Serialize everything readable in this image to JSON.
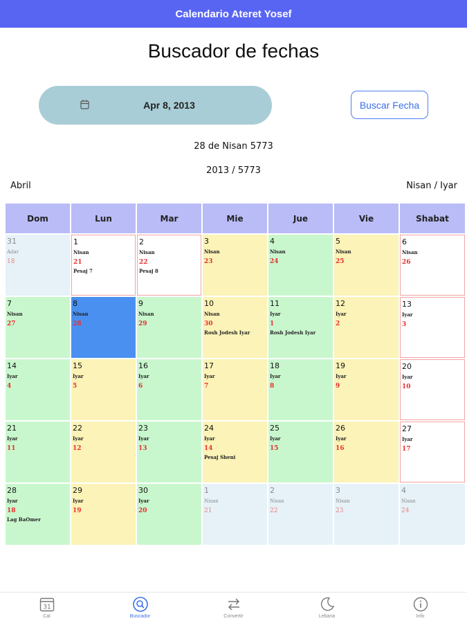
{
  "app": {
    "title": "Calendario Ateret Yosef"
  },
  "page": {
    "title": "Buscador de fechas"
  },
  "search": {
    "date_value": "Apr 8, 2013",
    "button_label": "Buscar Fecha"
  },
  "result": {
    "hebrew_date": "28 de Nisan 5773",
    "years": "2013 / 5773",
    "greg_month": "Abril",
    "hebrew_months": "Nisan / Iyar"
  },
  "calendar": {
    "weekdays": [
      "Dom",
      "Lun",
      "Mar",
      "Mie",
      "Jue",
      "Vie",
      "Shabat"
    ],
    "weeks": [
      [
        {
          "num": "31",
          "month": "Adar",
          "hday": "18",
          "note": "",
          "style": "blue"
        },
        {
          "num": "1",
          "month": "Nisan",
          "hday": "21",
          "note": "Pesaj 7",
          "style": "white"
        },
        {
          "num": "2",
          "month": "Nisan",
          "hday": "22",
          "note": "Pesaj 8",
          "style": "white"
        },
        {
          "num": "3",
          "month": "Nisan",
          "hday": "23",
          "note": "",
          "style": "yellow"
        },
        {
          "num": "4",
          "month": "Nisan",
          "hday": "24",
          "note": "",
          "style": "green"
        },
        {
          "num": "5",
          "month": "Nisan",
          "hday": "25",
          "note": "",
          "style": "yellow"
        },
        {
          "num": "6",
          "month": "Nisan",
          "hday": "26",
          "note": "",
          "style": "white"
        }
      ],
      [
        {
          "num": "7",
          "month": "Nisan",
          "hday": "27",
          "note": "",
          "style": "green"
        },
        {
          "num": "8",
          "month": "Nisan",
          "hday": "28",
          "note": "",
          "style": "selected"
        },
        {
          "num": "9",
          "month": "Nisan",
          "hday": "29",
          "note": "",
          "style": "green"
        },
        {
          "num": "10",
          "month": "Nisan",
          "hday": "30",
          "note": "Rosh Jodesh Iyar",
          "style": "yellow"
        },
        {
          "num": "11",
          "month": "Iyar",
          "hday": "1",
          "note": "Rosh Jodesh Iyar",
          "style": "green"
        },
        {
          "num": "12",
          "month": "Iyar",
          "hday": "2",
          "note": "",
          "style": "yellow"
        },
        {
          "num": "13",
          "month": "Iyar",
          "hday": "3",
          "note": "",
          "style": "white"
        }
      ],
      [
        {
          "num": "14",
          "month": "Iyar",
          "hday": "4",
          "note": "",
          "style": "green"
        },
        {
          "num": "15",
          "month": "Iyar",
          "hday": "5",
          "note": "",
          "style": "yellow"
        },
        {
          "num": "16",
          "month": "Iyar",
          "hday": "6",
          "note": "",
          "style": "green"
        },
        {
          "num": "17",
          "month": "Iyar",
          "hday": "7",
          "note": "",
          "style": "yellow"
        },
        {
          "num": "18",
          "month": "Iyar",
          "hday": "8",
          "note": "",
          "style": "green"
        },
        {
          "num": "19",
          "month": "Iyar",
          "hday": "9",
          "note": "",
          "style": "yellow"
        },
        {
          "num": "20",
          "month": "Iyar",
          "hday": "10",
          "note": "",
          "style": "white"
        }
      ],
      [
        {
          "num": "21",
          "month": "Iyar",
          "hday": "11",
          "note": "",
          "style": "green"
        },
        {
          "num": "22",
          "month": "Iyar",
          "hday": "12",
          "note": "",
          "style": "yellow"
        },
        {
          "num": "23",
          "month": "Iyar",
          "hday": "13",
          "note": "",
          "style": "green"
        },
        {
          "num": "24",
          "month": "Iyar",
          "hday": "14",
          "note": "Pesaj Sheni",
          "style": "yellow"
        },
        {
          "num": "25",
          "month": "Iyar",
          "hday": "15",
          "note": "",
          "style": "green"
        },
        {
          "num": "26",
          "month": "Iyar",
          "hday": "16",
          "note": "",
          "style": "yellow"
        },
        {
          "num": "27",
          "month": "Iyar",
          "hday": "17",
          "note": "",
          "style": "white"
        }
      ],
      [
        {
          "num": "28",
          "month": "Iyar",
          "hday": "18",
          "note": "Lag BaOmer",
          "style": "green"
        },
        {
          "num": "29",
          "month": "Iyar",
          "hday": "19",
          "note": "",
          "style": "yellow"
        },
        {
          "num": "30",
          "month": "Iyar",
          "hday": "20",
          "note": "",
          "style": "green"
        },
        {
          "num": "1",
          "month": "Nisan",
          "hday": "21",
          "note": "",
          "style": "blue"
        },
        {
          "num": "2",
          "month": "Nisan",
          "hday": "22",
          "note": "",
          "style": "blue"
        },
        {
          "num": "3",
          "month": "Nisan",
          "hday": "23",
          "note": "",
          "style": "blue"
        },
        {
          "num": "4",
          "month": "Nisan",
          "hday": "24",
          "note": "",
          "style": "blue"
        }
      ]
    ]
  },
  "nav": {
    "items": [
      {
        "label": "Cal",
        "icon": "calendar-icon",
        "badge": "31",
        "active": false
      },
      {
        "label": "Buscador",
        "icon": "search-icon",
        "active": true
      },
      {
        "label": "Convertir",
        "icon": "swap-icon",
        "active": false
      },
      {
        "label": "Lebana",
        "icon": "moon-icon",
        "active": false
      },
      {
        "label": "Info",
        "icon": "info-icon",
        "active": false
      }
    ]
  },
  "colors": {
    "appbar": "#5865f2",
    "accent": "#3b6fea",
    "pill": "#a8cdd6",
    "header": "#b9bcf7",
    "green": "#c9f7cd",
    "yellow": "#fbf3b7",
    "blue": "#e6f2f8",
    "selected": "#4a90f0",
    "holiday_border": "#f2a3a3",
    "hebrew_day": "#e53030"
  }
}
